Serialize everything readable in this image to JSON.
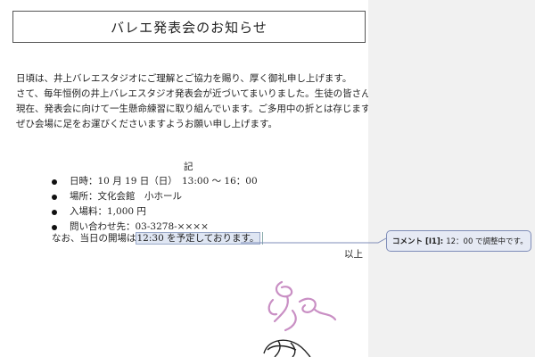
{
  "document": {
    "title": "バレエ発表会のお知らせ",
    "paragraphs": [
      "日頃は、井上バレエスタジオにご理解とご協力を賜り、厚く御礼申し上げます。",
      "さて、毎年恒例の井上バレエスタジオ発表会が近づいてまいりました。生徒の皆さんは、",
      "現在、発表会に向けて一生懸命練習に取り組んでいます。ご多用中の折とは存じますが、",
      "ぜひ会場に足をお運びくださいますようお願い申し上げます。"
    ],
    "ki": "記",
    "bullets": [
      "日時：10 月 19 日（日）　13:00 〜 16：00",
      "場所：文化会館　小ホール",
      "入場料：1,000 円",
      "問い合わせ先：03-3278-××××"
    ],
    "note_prefix": "なお、当日の開場は",
    "note_highlight": "12:30 を予定しております。",
    "closing": "以上"
  },
  "comment": {
    "author": "コメント [I1]:",
    "text": "12：00 で調整中です。"
  },
  "colors": {
    "highlight": "#dfe6f3",
    "comment_bg": "#e6eaf4",
    "comment_border": "#7f8db8",
    "margin_bg": "#f1f1f1"
  }
}
